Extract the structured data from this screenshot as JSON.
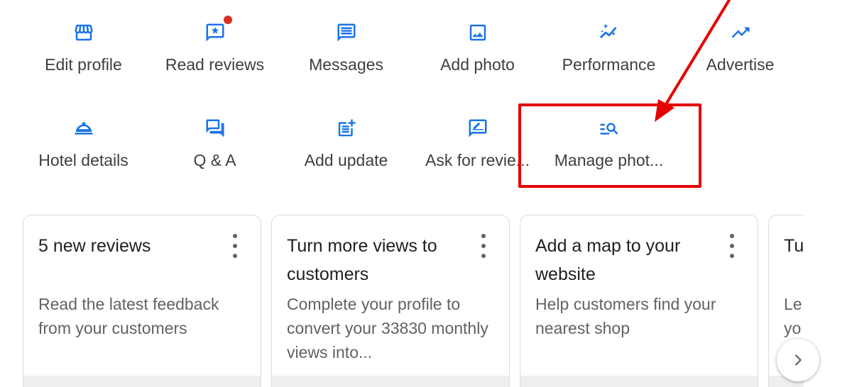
{
  "colors": {
    "accent": "#1a73e8",
    "annotation": "#e50000",
    "notification": "#d93025"
  },
  "actions_row1": [
    {
      "label": "Edit profile",
      "icon": "storefront-icon"
    },
    {
      "label": "Read reviews",
      "icon": "star-review-icon"
    },
    {
      "label": "Messages",
      "icon": "message-icon"
    },
    {
      "label": "Add photo",
      "icon": "photo-icon"
    },
    {
      "label": "Performance",
      "icon": "sparkle-trend-icon"
    },
    {
      "label": "Advertise",
      "icon": "trending-up-icon"
    }
  ],
  "actions_row2": [
    {
      "label": "Hotel details",
      "icon": "room-service-icon"
    },
    {
      "label": "Q & A",
      "icon": "forum-icon"
    },
    {
      "label": "Add update",
      "icon": "post-add-icon"
    },
    {
      "label": "Ask for revie...",
      "icon": "rate-review-icon"
    },
    {
      "label": "Manage phot...",
      "icon": "manage-search-icon"
    }
  ],
  "cards": [
    {
      "title": "5 new reviews",
      "body": "Read the latest feedback from your customers"
    },
    {
      "title": "Turn more views to customers",
      "body": "Complete your profile to convert your 33830 monthly views into..."
    },
    {
      "title": "Add a map to your website",
      "body": "Help customers find your nearest shop"
    },
    {
      "title": "Tu",
      "body": "Le yo"
    }
  ]
}
